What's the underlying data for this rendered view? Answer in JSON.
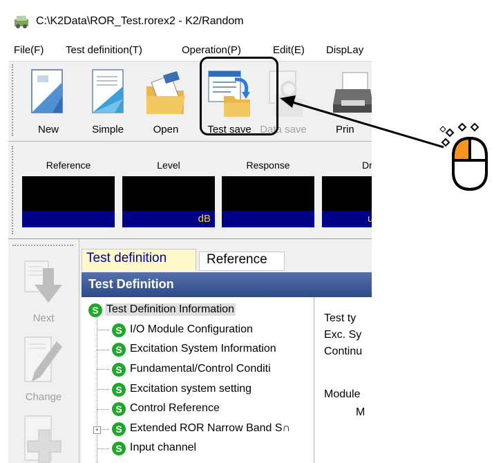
{
  "window": {
    "title": "C:\\K2Data\\ROR_Test.rorex2 - K2/Random",
    "app_icon": "k2-app-icon"
  },
  "menu": [
    {
      "label": "File(F)",
      "icon": ""
    },
    {
      "label": "Test definition(T)"
    },
    {
      "label": "Operation(P)"
    },
    {
      "label": "Edit(E)"
    },
    {
      "label": "DispLay"
    }
  ],
  "toolbar": {
    "new_label": "New",
    "simple_label": "Simple",
    "open_label": "Open",
    "test_save_label": "Test save",
    "data_save_label": "Data save",
    "print_label": "Prin"
  },
  "monitor": {
    "meters": [
      {
        "label": "Reference",
        "unit": ""
      },
      {
        "label": "Level",
        "unit": "dB"
      },
      {
        "label": "Response",
        "unit": ""
      },
      {
        "label": "Dri",
        "unit": "u"
      }
    ]
  },
  "side_buttons": {
    "next_label": "Next",
    "change_label": "Change"
  },
  "tabs": {
    "active": "Test definition",
    "inactive": "Reference"
  },
  "panel": {
    "header": "Test Definition",
    "tree": [
      {
        "label": "Test Definition Information"
      },
      {
        "label": "I/O Module Configuration"
      },
      {
        "label": "Excitation System Information"
      },
      {
        "label": "Fundamental/Control Conditi"
      },
      {
        "label": "Excitation system setting"
      },
      {
        "label": "Control Reference"
      },
      {
        "label": "Extended ROR Narrow Band S∩"
      },
      {
        "label": "Input channel"
      }
    ],
    "tree_icon_letter": "S",
    "details": [
      "Test ty",
      "Exc. Sy",
      "Continu",
      "Module",
      "M"
    ]
  },
  "colors": {
    "meter_unit_bg": "#000088",
    "meter_unit_text": "#ffd800",
    "tab_active_bg": "#fff8c8",
    "tab_active_text": "#000099",
    "tree_icon": "#1ea82a",
    "mouse_accent": "#f7941d"
  }
}
